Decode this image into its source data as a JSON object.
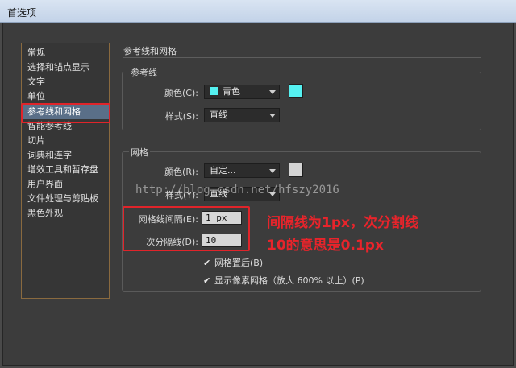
{
  "window": {
    "title": "首选项"
  },
  "sidebar": {
    "items": [
      {
        "label": "常规"
      },
      {
        "label": "选择和锚点显示"
      },
      {
        "label": "文字"
      },
      {
        "label": "单位"
      },
      {
        "label": "参考线和网格",
        "selected": true
      },
      {
        "label": "智能参考线"
      },
      {
        "label": "切片"
      },
      {
        "label": "词典和连字"
      },
      {
        "label": "增效工具和暂存盘"
      },
      {
        "label": "用户界面"
      },
      {
        "label": "文件处理与剪贴板"
      },
      {
        "label": "黑色外观"
      }
    ]
  },
  "main": {
    "section_title": "参考线和网格",
    "guides": {
      "group_label": "参考线",
      "color_label": "颜色(C):",
      "color_value": "青色",
      "color_swatch": "#55f1f1",
      "style_label": "样式(S):",
      "style_value": "直线"
    },
    "grid": {
      "group_label": "网格",
      "color_label": "颜色(R):",
      "color_value": "自定...",
      "color_swatch": "#d4d4d4",
      "style_label": "样式(Y):",
      "style_value": "直线",
      "gridline_label": "网格线间隔(E):",
      "gridline_value": "1 px",
      "subdivision_label": "次分隔线(D):",
      "subdivision_value": "10",
      "grids_in_back_label": "网格置后(B)",
      "grids_in_back_checked": true,
      "show_pixel_grid_label": "显示像素网格（放大 600% 以上）(P)",
      "show_pixel_grid_checked": true
    }
  },
  "annotation": {
    "line1": "间隔线为1px，次分割线",
    "line2": "10的意思是0.1px",
    "color": "#e8242b"
  },
  "watermark": "http://blog.csdn.net/hfszy2016"
}
